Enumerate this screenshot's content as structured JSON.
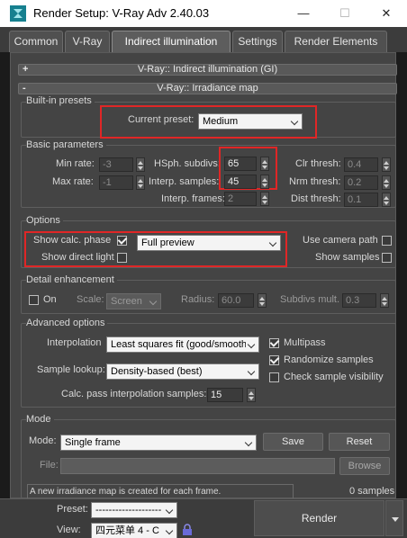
{
  "window": {
    "title": "Render Setup: V-Ray Adv 2.40.03",
    "minimize": "—",
    "maximize": "☐",
    "close": "✕"
  },
  "tabs": [
    {
      "label": "Common",
      "active": false
    },
    {
      "label": "V-Ray",
      "active": false
    },
    {
      "label": "Indirect illumination",
      "active": true
    },
    {
      "label": "Settings",
      "active": false
    },
    {
      "label": "Render Elements",
      "active": false
    }
  ],
  "rollouts": {
    "gi": {
      "sign": "+",
      "title": "V-Ray:: Indirect illumination (GI)"
    },
    "irradiance": {
      "sign": "-",
      "title": "V-Ray:: Irradiance map"
    }
  },
  "presets": {
    "group_title": "Built-in presets",
    "current_preset_label": "Current preset:",
    "current_preset_value": "Medium"
  },
  "basic": {
    "group_title": "Basic parameters",
    "min_rate_label": "Min rate:",
    "min_rate": "-3",
    "max_rate_label": "Max rate:",
    "max_rate": "-1",
    "hsph_label": "HSph. subdivs:",
    "hsph": "65",
    "interp_samples_label": "Interp. samples:",
    "interp_samples": "45",
    "interp_frames_label": "Interp. frames:",
    "interp_frames": "2",
    "clr_thresh_label": "Clr thresh:",
    "clr_thresh": "0.4",
    "nrm_thresh_label": "Nrm thresh:",
    "nrm_thresh": "0.2",
    "dist_thresh_label": "Dist thresh:",
    "dist_thresh": "0.1"
  },
  "options": {
    "group_title": "Options",
    "show_calc_label": "Show calc. phase",
    "show_calc_checked": true,
    "preview_value": "Full preview",
    "show_direct_label": "Show direct light",
    "show_direct_checked": false,
    "use_camera_label": "Use camera path",
    "use_camera_checked": false,
    "show_samples_label": "Show samples",
    "show_samples_checked": false
  },
  "detail": {
    "group_title": "Detail enhancement",
    "on_label": "On",
    "on_checked": false,
    "scale_label": "Scale:",
    "scale_value": "Screen",
    "radius_label": "Radius:",
    "radius": "60.0",
    "subdivs_mult_label": "Subdivs mult.",
    "subdivs_mult": "0.3"
  },
  "advanced": {
    "group_title": "Advanced options",
    "interpolation_label": "Interpolation",
    "interpolation_value": "Least squares fit (good/smooth",
    "multipass_label": "Multipass",
    "multipass_checked": true,
    "sample_lookup_label": "Sample lookup:",
    "sample_lookup_value": "Density-based (best)",
    "randomize_label": "Randomize samples",
    "randomize_checked": true,
    "check_visibility_label": "Check sample visibility",
    "check_visibility_checked": false,
    "calc_pass_label": "Calc. pass interpolation samples:",
    "calc_pass": "15"
  },
  "mode": {
    "group_title": "Mode",
    "mode_label": "Mode:",
    "mode_value": "Single frame",
    "save_label": "Save",
    "reset_label": "Reset",
    "file_label": "File:",
    "browse_label": "Browse",
    "info_text": "A new irradiance map is created for each frame.",
    "samples_text": "0 samples"
  },
  "bottom": {
    "preset_label": "Preset:",
    "preset_value": "--------------------",
    "view_label": "View:",
    "view_value": "四元菜单 4 - C",
    "render_label": "Render"
  },
  "colors": {
    "highlight": "#e02626",
    "panel": "#444444"
  }
}
